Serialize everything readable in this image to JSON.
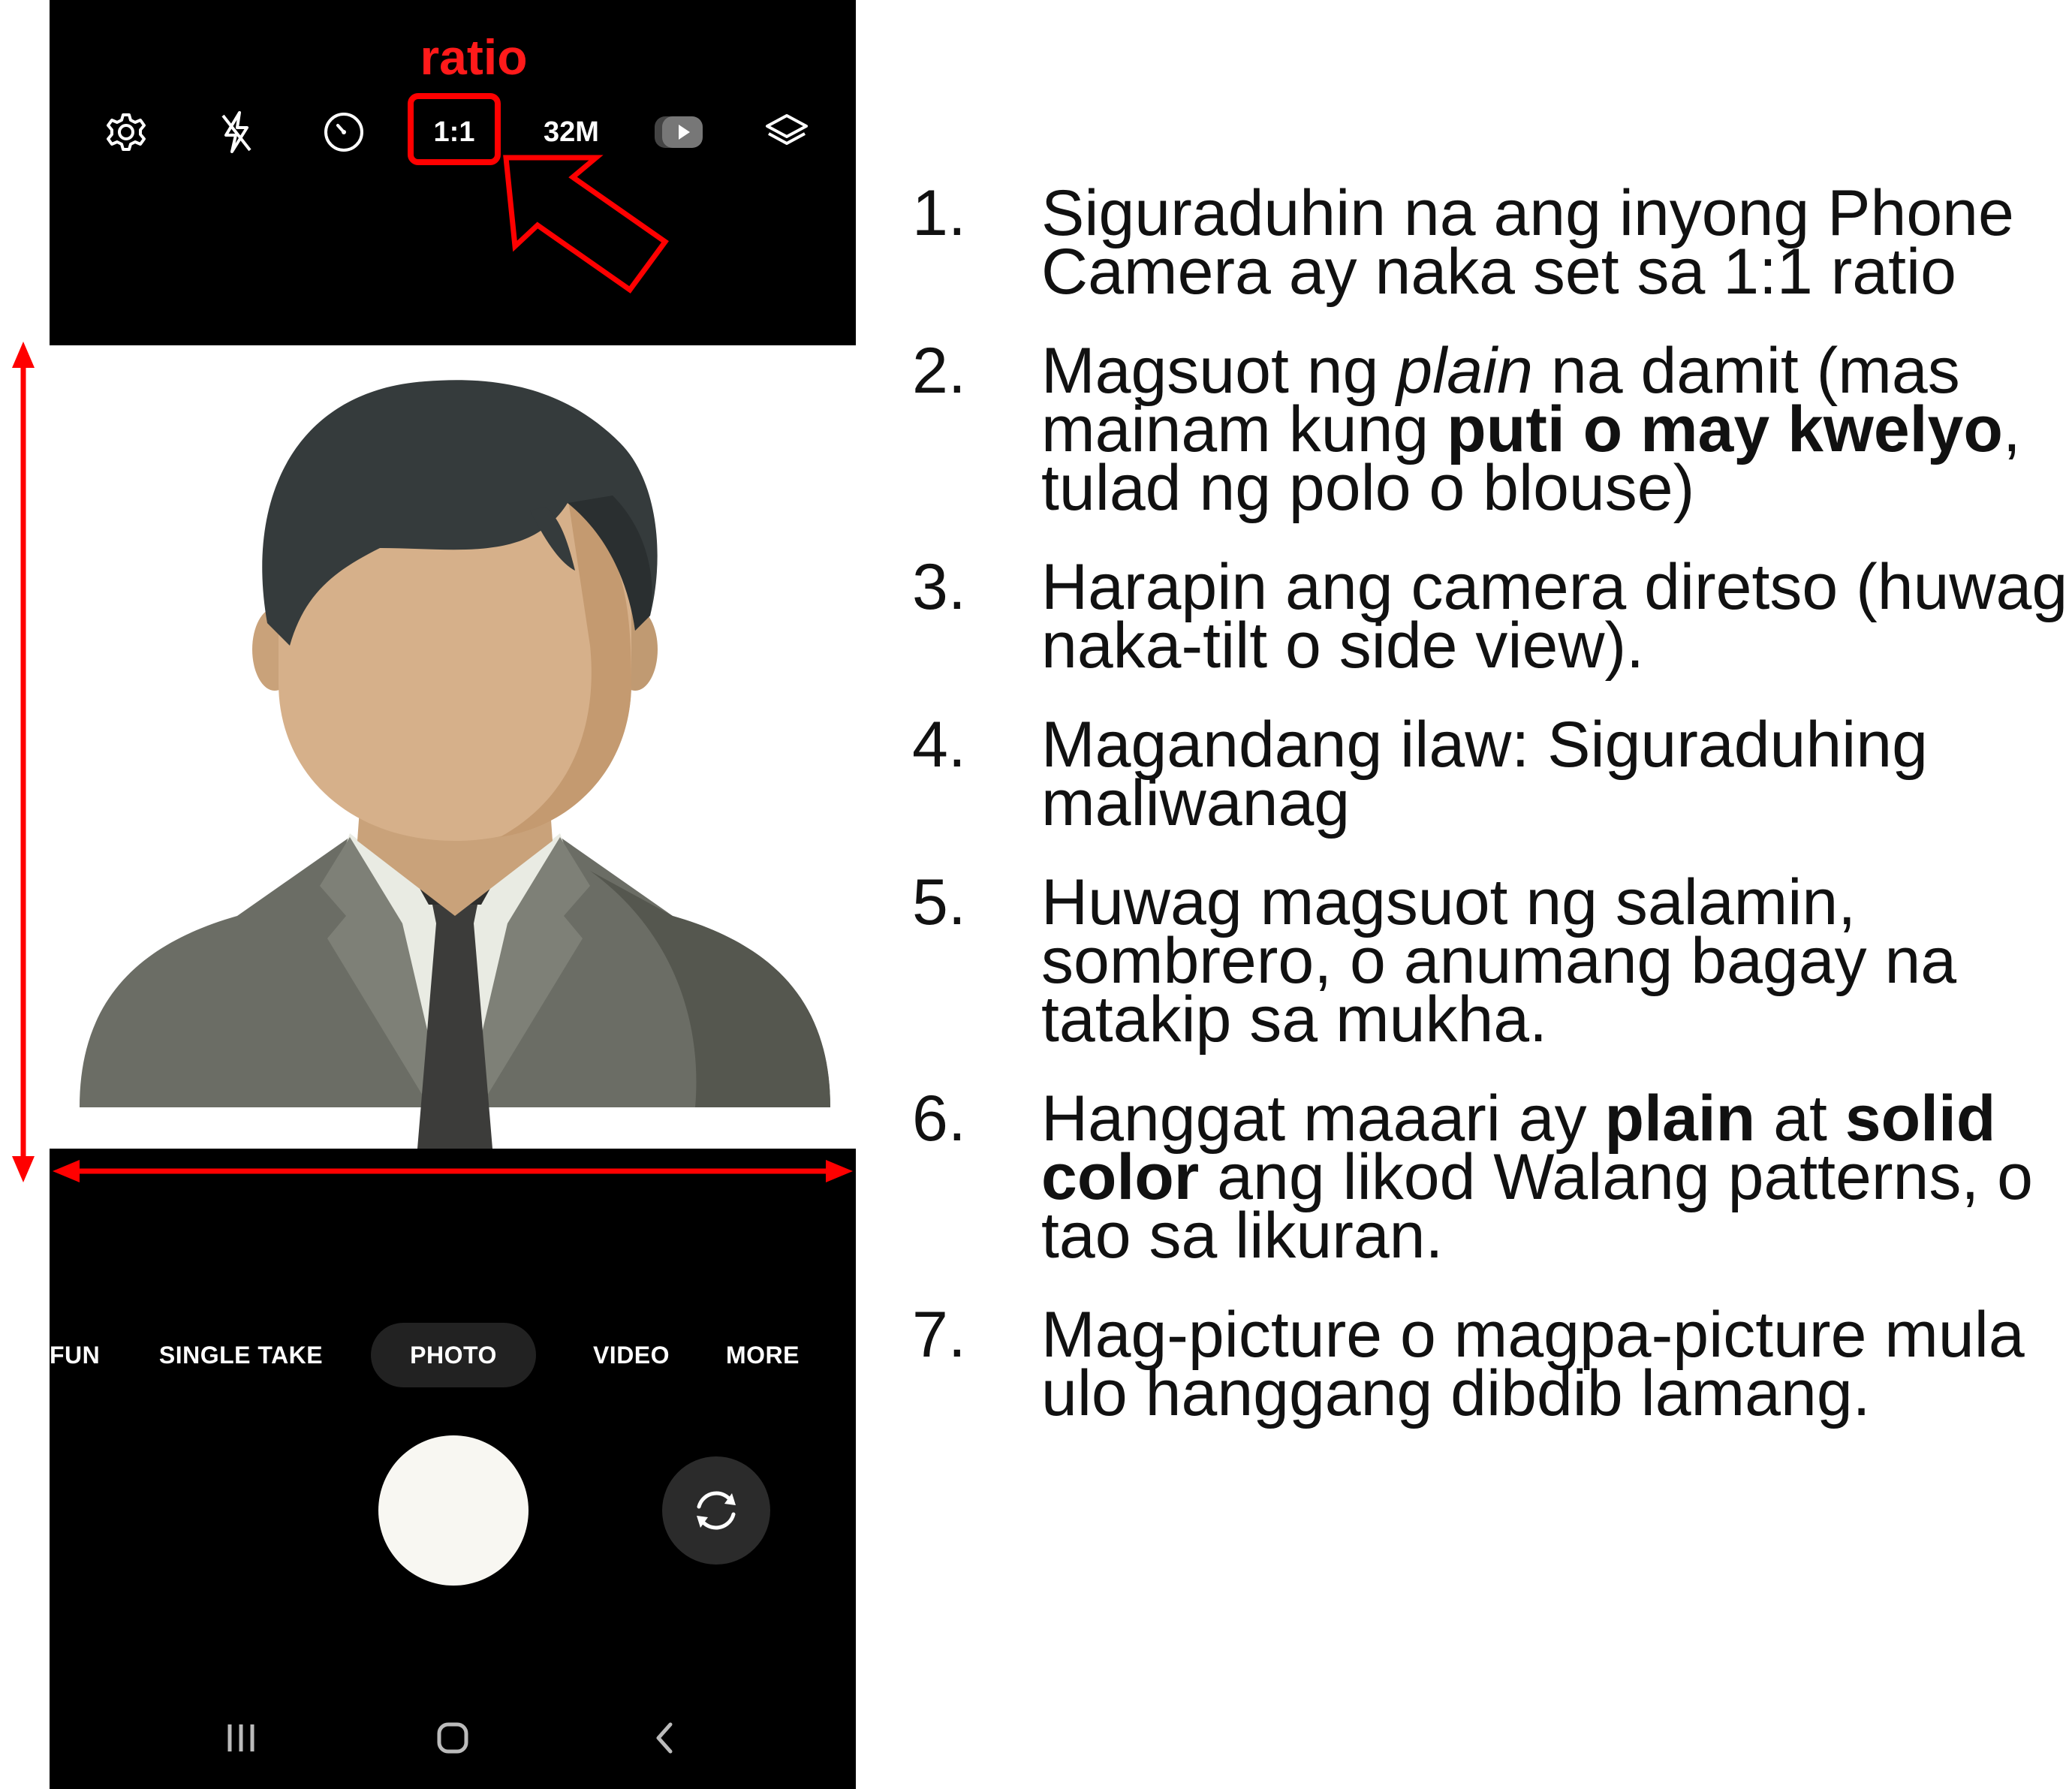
{
  "annotation": {
    "ratio_caption": "ratio",
    "accent_color": "#ff0000"
  },
  "camera": {
    "topbar": {
      "settings_icon": "gear-icon",
      "flash_icon": "flash-off-icon",
      "timer_icon": "timer-icon",
      "ratio_label": "1:1",
      "resolution_label": "32M",
      "motion_icon": "motion-photo-icon",
      "filters_icon": "layers-icon"
    },
    "modes": [
      {
        "label": "FUN"
      },
      {
        "label": "SINGLE TAKE"
      },
      {
        "label": "PHOTO"
      },
      {
        "label": "VIDEO"
      },
      {
        "label": "MORE"
      }
    ],
    "active_mode": "PHOTO",
    "shutter_icon": "shutter-button",
    "flip_icon": "flip-camera-icon",
    "nav": {
      "recents_icon": "recents-icon",
      "home_icon": "home-icon",
      "back_icon": "back-icon"
    }
  },
  "instructions": [
    {
      "num": "1.",
      "parts": [
        {
          "t": "Siguraduhin na ang inyong Phone Camera ay naka set sa 1:1 ratio"
        }
      ]
    },
    {
      "num": "2.",
      "parts": [
        {
          "t": "Magsuot ng "
        },
        {
          "t": "plain",
          "style": "italic"
        },
        {
          "t": " na damit (mas mainam kung "
        },
        {
          "t": "puti o may kwelyo",
          "style": "bold"
        },
        {
          "t": ", tulad ng polo o blouse)"
        }
      ]
    },
    {
      "num": "3.",
      "parts": [
        {
          "t": "Harapin ang camera diretso (huwag naka-tilt o side view)."
        }
      ]
    },
    {
      "num": "4.",
      "parts": [
        {
          "t": "Magandang ilaw: Siguraduhing maliwanag"
        }
      ]
    },
    {
      "num": "5.",
      "parts": [
        {
          "t": "Huwag magsuot ng salamin, sombrero, o anumang bagay na tatakip sa mukha."
        }
      ]
    },
    {
      "num": "6.",
      "parts": [
        {
          "t": "Hanggat maaari ay "
        },
        {
          "t": "plain",
          "style": "bold"
        },
        {
          "t": " at "
        },
        {
          "t": "solid color",
          "style": "bold"
        },
        {
          "t": " ang likod Walang patterns, o tao sa likuran."
        }
      ]
    },
    {
      "num": "7.",
      "parts": [
        {
          "t": "Mag-picture o magpa-picture mula ulo hanggang dibdib lamang."
        }
      ]
    }
  ]
}
